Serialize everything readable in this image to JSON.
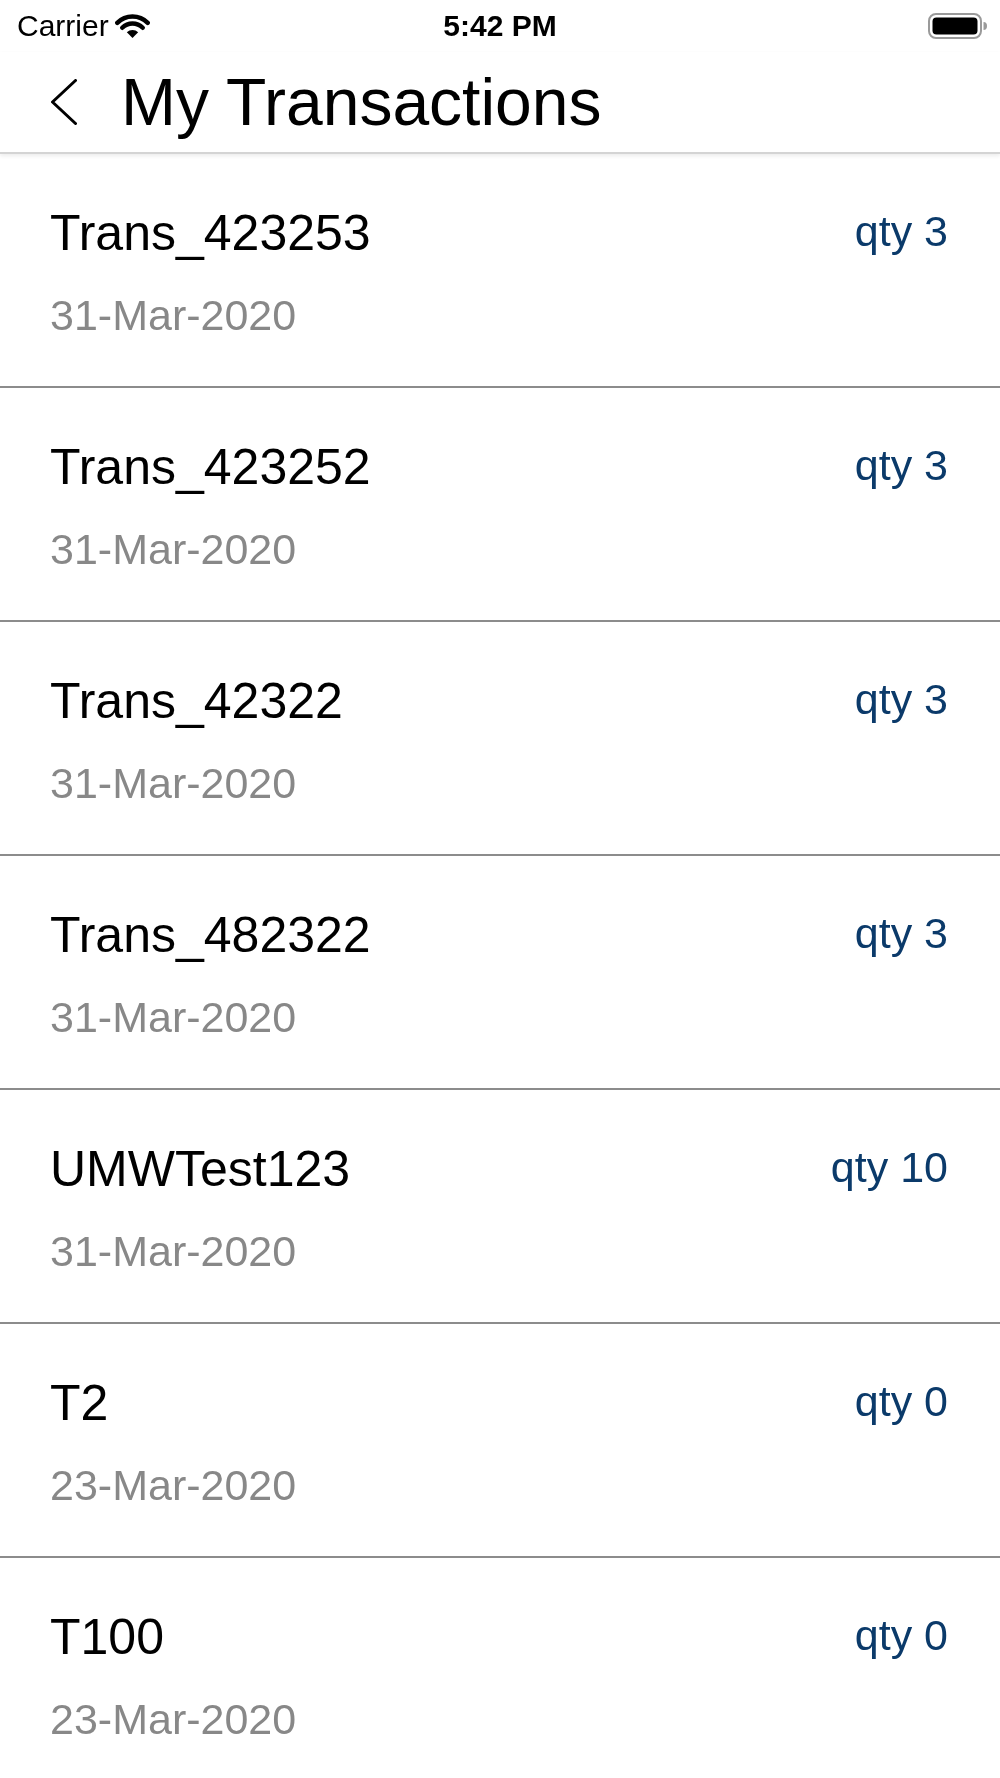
{
  "status_bar": {
    "carrier": "Carrier",
    "time": "5:42 PM"
  },
  "nav": {
    "title": "My Transactions"
  },
  "transactions": [
    {
      "name": "Trans_423253",
      "date": "31-Mar-2020",
      "quantity": "qty 3"
    },
    {
      "name": "Trans_423252",
      "date": "31-Mar-2020",
      "quantity": "qty 3"
    },
    {
      "name": "Trans_42322",
      "date": "31-Mar-2020",
      "quantity": "qty 3"
    },
    {
      "name": "Trans_482322",
      "date": "31-Mar-2020",
      "quantity": "qty 3"
    },
    {
      "name": "UMWTest123",
      "date": "31-Mar-2020",
      "quantity": "qty 10"
    },
    {
      "name": "T2",
      "date": "23-Mar-2020",
      "quantity": "qty 0"
    },
    {
      "name": "T100",
      "date": "23-Mar-2020",
      "quantity": "qty 0"
    }
  ]
}
